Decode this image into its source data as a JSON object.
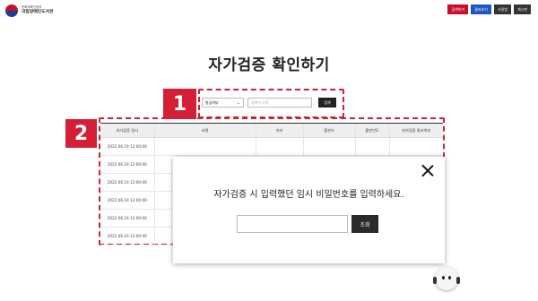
{
  "header": {
    "logo_line1": "문화체육관광부",
    "logo_line2": "국립장애인도서관",
    "buttons": [
      {
        "label": "검색하기",
        "color": "#c8102e"
      },
      {
        "label": "결과보기",
        "color": "#1f56c3"
      },
      {
        "label": "사용법",
        "color": "#333333"
      },
      {
        "label": "게시판",
        "color": "#333333"
      }
    ]
  },
  "page_title": "자가검증 확인하기",
  "annotations": {
    "badge1": "1",
    "badge2": "2",
    "highlight_color": "#d51f37"
  },
  "search": {
    "select_value": "발급여부",
    "placeholder": "검색어 입력",
    "button_label": "검색"
  },
  "table": {
    "columns": [
      "자가검증 일시",
      "서명",
      "저자",
      "출판사",
      "출판년도",
      "자가검증 통과여부"
    ],
    "rows": [
      [
        "2022.06.19 12:00:00"
      ],
      [
        "2022.06.19 12:00:00"
      ],
      [
        "2022.06.19 12:00:00"
      ],
      [
        "2022.06.19 12:00:00"
      ],
      [
        "2022.06.19 12:00:00"
      ],
      [
        "2022.06.19 12:00:00"
      ]
    ]
  },
  "modal": {
    "message": "자가검증 시 입력했던 임시 비밀번호를 입력하세요.",
    "confirm_label": "조회"
  }
}
